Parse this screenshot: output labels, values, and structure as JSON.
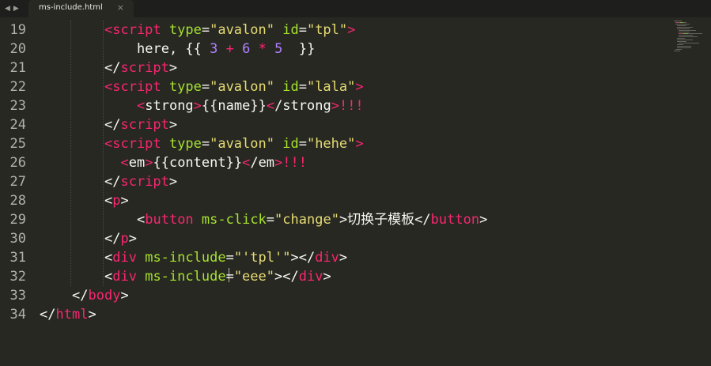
{
  "tab": {
    "title": "ms-include.html",
    "close": "×"
  },
  "nav": {
    "back": "◀",
    "forward": "▶"
  },
  "tabbar_right": "",
  "lines": [
    {
      "num": "19",
      "indent": 4,
      "tokens": [
        [
          "tag",
          "<script "
        ],
        [
          "attr",
          "type"
        ],
        [
          "text",
          "="
        ],
        [
          "str",
          "\"avalon\" "
        ],
        [
          "attr",
          "id"
        ],
        [
          "text",
          "="
        ],
        [
          "str",
          "\"tpl\""
        ],
        [
          "tag",
          ">"
        ]
      ]
    },
    {
      "num": "20",
      "indent": 6,
      "tokens": [
        [
          "text",
          "here, {{ "
        ],
        [
          "num",
          "3"
        ],
        [
          "text",
          " "
        ],
        [
          "op",
          "+"
        ],
        [
          "text",
          " "
        ],
        [
          "num",
          "6"
        ],
        [
          "text",
          " "
        ],
        [
          "op",
          "*"
        ],
        [
          "text",
          " "
        ],
        [
          "num",
          "5"
        ],
        [
          "text",
          "  }}"
        ]
      ]
    },
    {
      "num": "21",
      "indent": 4,
      "tokens": [
        [
          "text",
          "</"
        ],
        [
          "tag",
          "script"
        ],
        [
          "text",
          ">"
        ]
      ]
    },
    {
      "num": "22",
      "indent": 4,
      "tokens": [
        [
          "tag",
          "<script "
        ],
        [
          "attr",
          "type"
        ],
        [
          "text",
          "="
        ],
        [
          "str",
          "\"avalon\" "
        ],
        [
          "attr",
          "id"
        ],
        [
          "text",
          "="
        ],
        [
          "str",
          "\"lala\""
        ],
        [
          "tag",
          ">"
        ]
      ]
    },
    {
      "num": "23",
      "indent": 6,
      "tokens": [
        [
          "tag",
          "<"
        ],
        [
          "text",
          "strong"
        ],
        [
          "tag",
          ">"
        ],
        [
          "text",
          "{{name}}"
        ],
        [
          "tag",
          "<"
        ],
        [
          "text",
          "/strong"
        ],
        [
          "tag",
          ">!!!"
        ]
      ]
    },
    {
      "num": "24",
      "indent": 4,
      "tokens": [
        [
          "text",
          "</"
        ],
        [
          "tag",
          "script"
        ],
        [
          "text",
          ">"
        ]
      ]
    },
    {
      "num": "25",
      "indent": 4,
      "tokens": [
        [
          "tag",
          "<script "
        ],
        [
          "attr",
          "type"
        ],
        [
          "text",
          "="
        ],
        [
          "str",
          "\"avalon\" "
        ],
        [
          "attr",
          "id"
        ],
        [
          "text",
          "="
        ],
        [
          "str",
          "\"hehe\""
        ],
        [
          "tag",
          ">"
        ]
      ]
    },
    {
      "num": "26",
      "indent": 5,
      "tokens": [
        [
          "tag",
          "<"
        ],
        [
          "text",
          "em"
        ],
        [
          "tag",
          ">"
        ],
        [
          "text",
          "{{content}}"
        ],
        [
          "tag",
          "<"
        ],
        [
          "text",
          "/em"
        ],
        [
          "tag",
          ">!!!"
        ]
      ]
    },
    {
      "num": "27",
      "indent": 4,
      "tokens": [
        [
          "text",
          "</"
        ],
        [
          "tag",
          "script"
        ],
        [
          "text",
          ">"
        ]
      ]
    },
    {
      "num": "28",
      "indent": 4,
      "tokens": [
        [
          "text",
          "<"
        ],
        [
          "tag",
          "p"
        ],
        [
          "text",
          ">"
        ]
      ]
    },
    {
      "num": "29",
      "indent": 6,
      "tokens": [
        [
          "text",
          "<"
        ],
        [
          "tag",
          "button "
        ],
        [
          "attr",
          "ms-click"
        ],
        [
          "text",
          "="
        ],
        [
          "str",
          "\"change\""
        ],
        [
          "text",
          ">切换子模板</"
        ],
        [
          "tag",
          "button"
        ],
        [
          "text",
          ">"
        ]
      ]
    },
    {
      "num": "30",
      "indent": 4,
      "tokens": [
        [
          "text",
          "</"
        ],
        [
          "tag",
          "p"
        ],
        [
          "text",
          ">"
        ]
      ]
    },
    {
      "num": "31",
      "indent": 4,
      "tokens": [
        [
          "text",
          "<"
        ],
        [
          "tag",
          "div "
        ],
        [
          "attr",
          "ms-include"
        ],
        [
          "text",
          "="
        ],
        [
          "str",
          "\"'tpl'\""
        ],
        [
          "text",
          "></"
        ],
        [
          "tag",
          "div"
        ],
        [
          "text",
          ">"
        ]
      ]
    },
    {
      "num": "32",
      "indent": 4,
      "tokens": [
        [
          "text",
          "<"
        ],
        [
          "tag",
          "div "
        ],
        [
          "attr",
          "ms-include"
        ],
        [
          "text",
          "="
        ],
        [
          "str",
          "\"eee\""
        ],
        [
          "text",
          "></"
        ],
        [
          "tag",
          "div"
        ],
        [
          "text",
          ">"
        ]
      ]
    },
    {
      "num": "33",
      "indent": 2,
      "tokens": [
        [
          "text",
          "</"
        ],
        [
          "tag",
          "body"
        ],
        [
          "text",
          ">"
        ]
      ]
    },
    {
      "num": "34",
      "indent": 0,
      "tokens": [
        [
          "text",
          "</"
        ],
        [
          "tag",
          "html"
        ],
        [
          "text",
          ">"
        ]
      ]
    }
  ],
  "colors": {
    "background": "#272822",
    "tag": "#f92672",
    "attribute": "#a6e22e",
    "string": "#e6db74",
    "number": "#ae81ff",
    "text": "#f8f8f2",
    "line_number": "#b1b1aa"
  }
}
